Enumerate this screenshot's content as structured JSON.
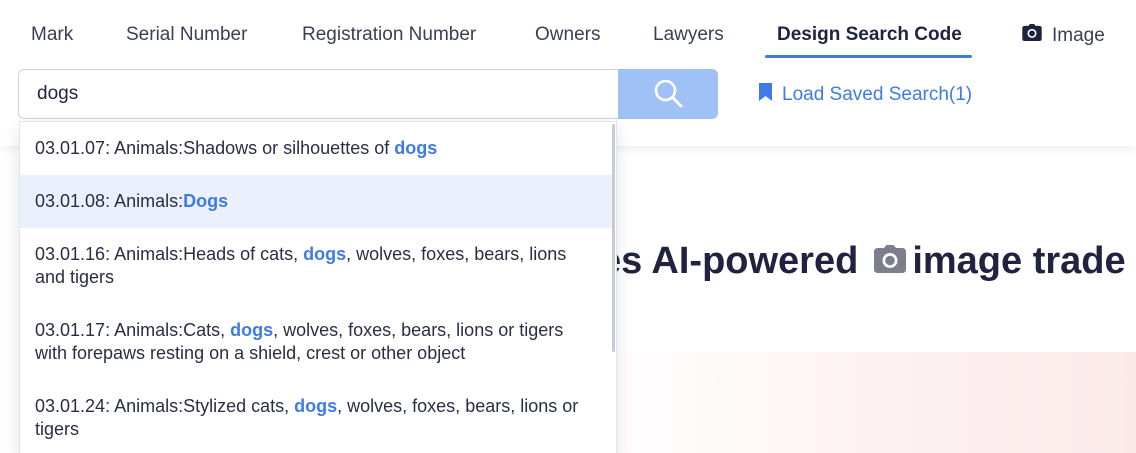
{
  "tabs": [
    {
      "label": "Mark"
    },
    {
      "label": "Serial Number"
    },
    {
      "label": "Registration Number"
    },
    {
      "label": "Owners"
    },
    {
      "label": "Lawyers"
    },
    {
      "label": "Design Search Code"
    },
    {
      "label": "Image"
    }
  ],
  "active_tab": "Design Search Code",
  "search": {
    "value": "dogs",
    "placeholder": ""
  },
  "saved_search": {
    "label": "Load Saved Search(1)"
  },
  "dropdown": {
    "selected_index": 1,
    "options": [
      {
        "before": "03.01.07: Animals:Shadows or silhouettes of ",
        "match": "dogs",
        "after": ""
      },
      {
        "before": "03.01.08: Animals:",
        "match": "Dogs",
        "after": ""
      },
      {
        "before": "03.01.16: Animals:Heads of cats, ",
        "match": "dogs",
        "after": ", wolves, foxes, bears, lions and tigers"
      },
      {
        "before": "03.01.17: Animals:Cats, ",
        "match": "dogs",
        "after": ", wolves, foxes, bears, lions or tigers with forepaws resting on a shield, crest or other object"
      },
      {
        "before": "03.01.24: Animals:Stylized cats, ",
        "match": "dogs",
        "after": ", wolves, foxes, bears, lions or tigers"
      }
    ]
  },
  "hero": {
    "text_before": "es AI-powered",
    "text_after": "image trade"
  },
  "colors": {
    "accent": "#3e7be6",
    "search_button": "#9fc1f6",
    "selected_row": "#eaf0fc",
    "text_dark": "#1f2340"
  }
}
